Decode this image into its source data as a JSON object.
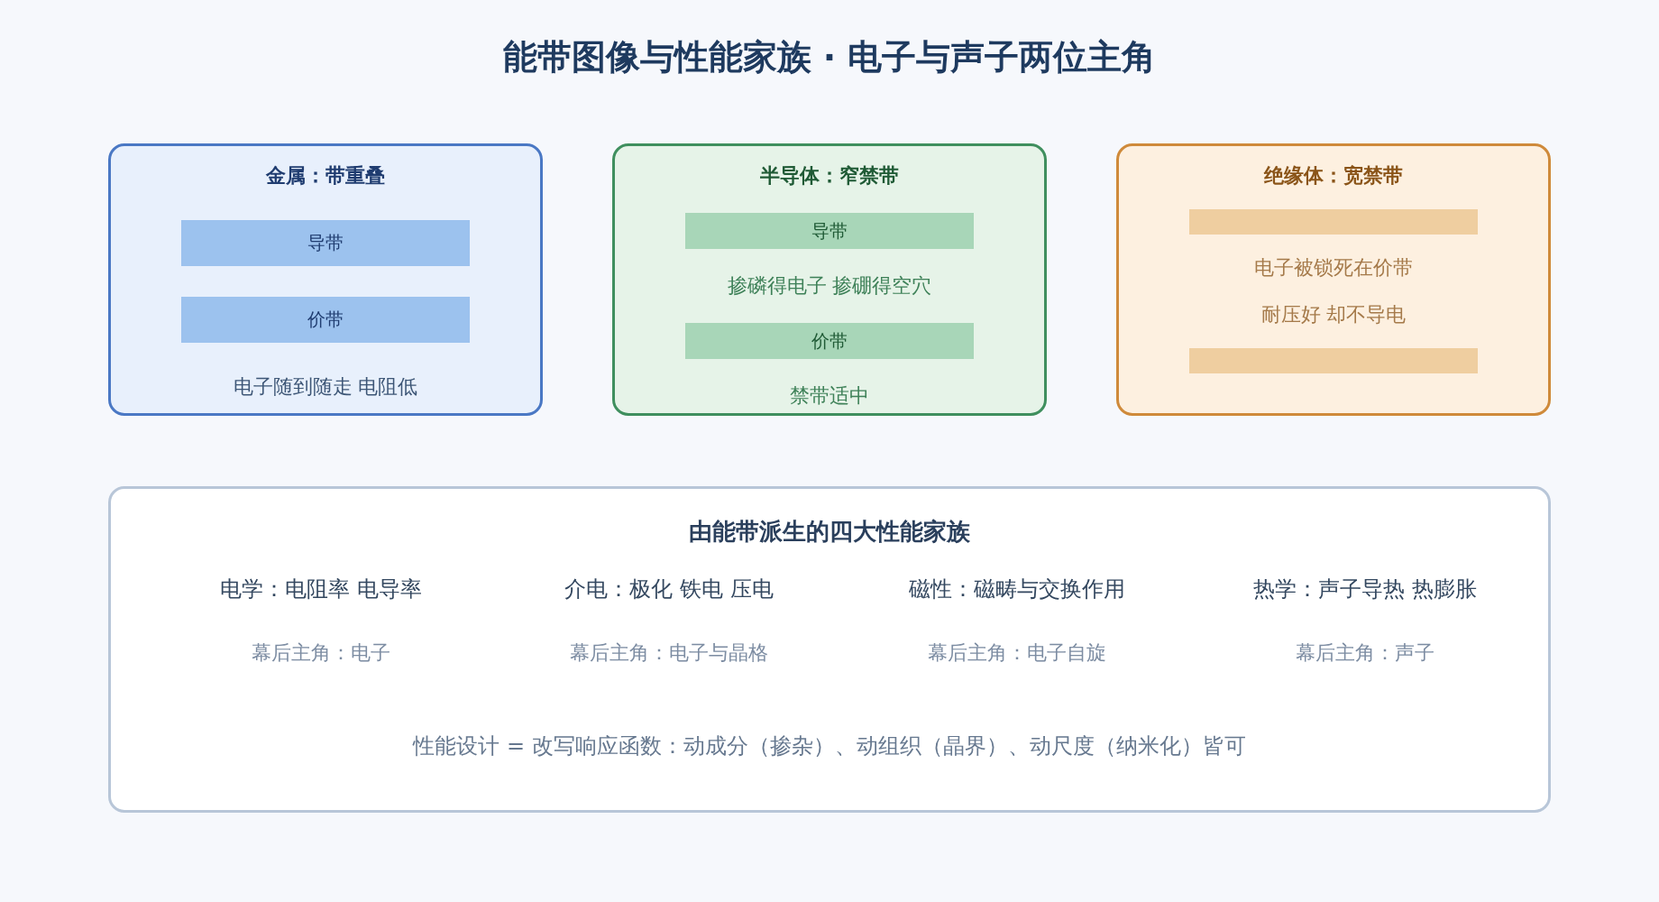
{
  "title": "能带图像与性能家族 · 电子与声子两位主角",
  "cards": [
    {
      "kind": "metal",
      "title": "金属：带重叠",
      "items": [
        {
          "kind": "band",
          "label": "导带"
        },
        {
          "kind": "band",
          "label": "价带"
        },
        {
          "kind": "text",
          "text": "电子随到随走 电阻低"
        }
      ]
    },
    {
      "kind": "semiconductor",
      "title": "半导体：窄禁带",
      "items": [
        {
          "kind": "band",
          "label": "导带"
        },
        {
          "kind": "text",
          "text": "掺磷得电子 掺硼得空穴"
        },
        {
          "kind": "band",
          "label": "价带"
        },
        {
          "kind": "text",
          "text": "禁带适中"
        }
      ]
    },
    {
      "kind": "insulator",
      "title": "绝缘体：宽禁带",
      "items": [
        {
          "kind": "band"
        },
        {
          "kind": "text",
          "text": "电子被锁死在价带"
        },
        {
          "kind": "text",
          "text": "耐压好 却不导电"
        },
        {
          "kind": "band"
        }
      ]
    }
  ],
  "families": {
    "title": "由能带派生的四大性能家族",
    "columns": [
      {
        "name": "电学：电阻率 电导率",
        "driver": "幕后主角：电子"
      },
      {
        "name": "介电：极化 铁电 压电",
        "driver": "幕后主角：电子与晶格"
      },
      {
        "name": "磁性：磁畴与交换作用",
        "driver": "幕后主角：电子自旋"
      },
      {
        "name": "热学：声子导热 热膨胀",
        "driver": "幕后主角：声子"
      }
    ],
    "footer": "性能设计 = 改写响应函数：动成分（掺杂）、动组织（晶界）、动尺度（纳米化）皆可"
  }
}
